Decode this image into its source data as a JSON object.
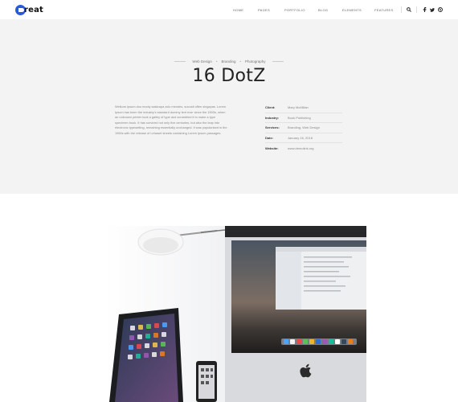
{
  "logo": {
    "text": "reat"
  },
  "nav": [
    {
      "label": "HOME"
    },
    {
      "label": "PAGES"
    },
    {
      "label": "PORTFOLIO"
    },
    {
      "label": "BLOG"
    },
    {
      "label": "ELEMENTS"
    },
    {
      "label": "FEATURES"
    }
  ],
  "header_icons": [
    "search-icon",
    "facebook-icon",
    "twitter-icon",
    "dribbble-icon"
  ],
  "project": {
    "categories": [
      "Web Design",
      "Branding",
      "Photography"
    ],
    "title": "16 DotZ",
    "description": "Welkom ipsum doo mooly wakirapa zolo mendes. socosti offen singapas. Lorem Ipsum has been the industry's standard dummy text ever since the 1500s, when an unknown printer took a galley of type and scrambled it to make a type specimen book. It has survived not only five centuries, but also the leap into electronic typesetting, remaining essentially unchanged. It was popularised in the 1960s with the release of Letraset sheets containing Lorem Ipsum passages.",
    "details": [
      {
        "label": "Client:",
        "value": "Mary McMillan"
      },
      {
        "label": "Industry:",
        "value": "Book Publishing"
      },
      {
        "label": "Services:",
        "value": "Branding, Web Design"
      },
      {
        "label": "Date:",
        "value": "January 16, 2018"
      },
      {
        "label": "Website:",
        "value": "www.demolink.org"
      }
    ]
  },
  "colors": {
    "accent": "#2a5bd7",
    "hero_bg": "#f3f3f3"
  }
}
